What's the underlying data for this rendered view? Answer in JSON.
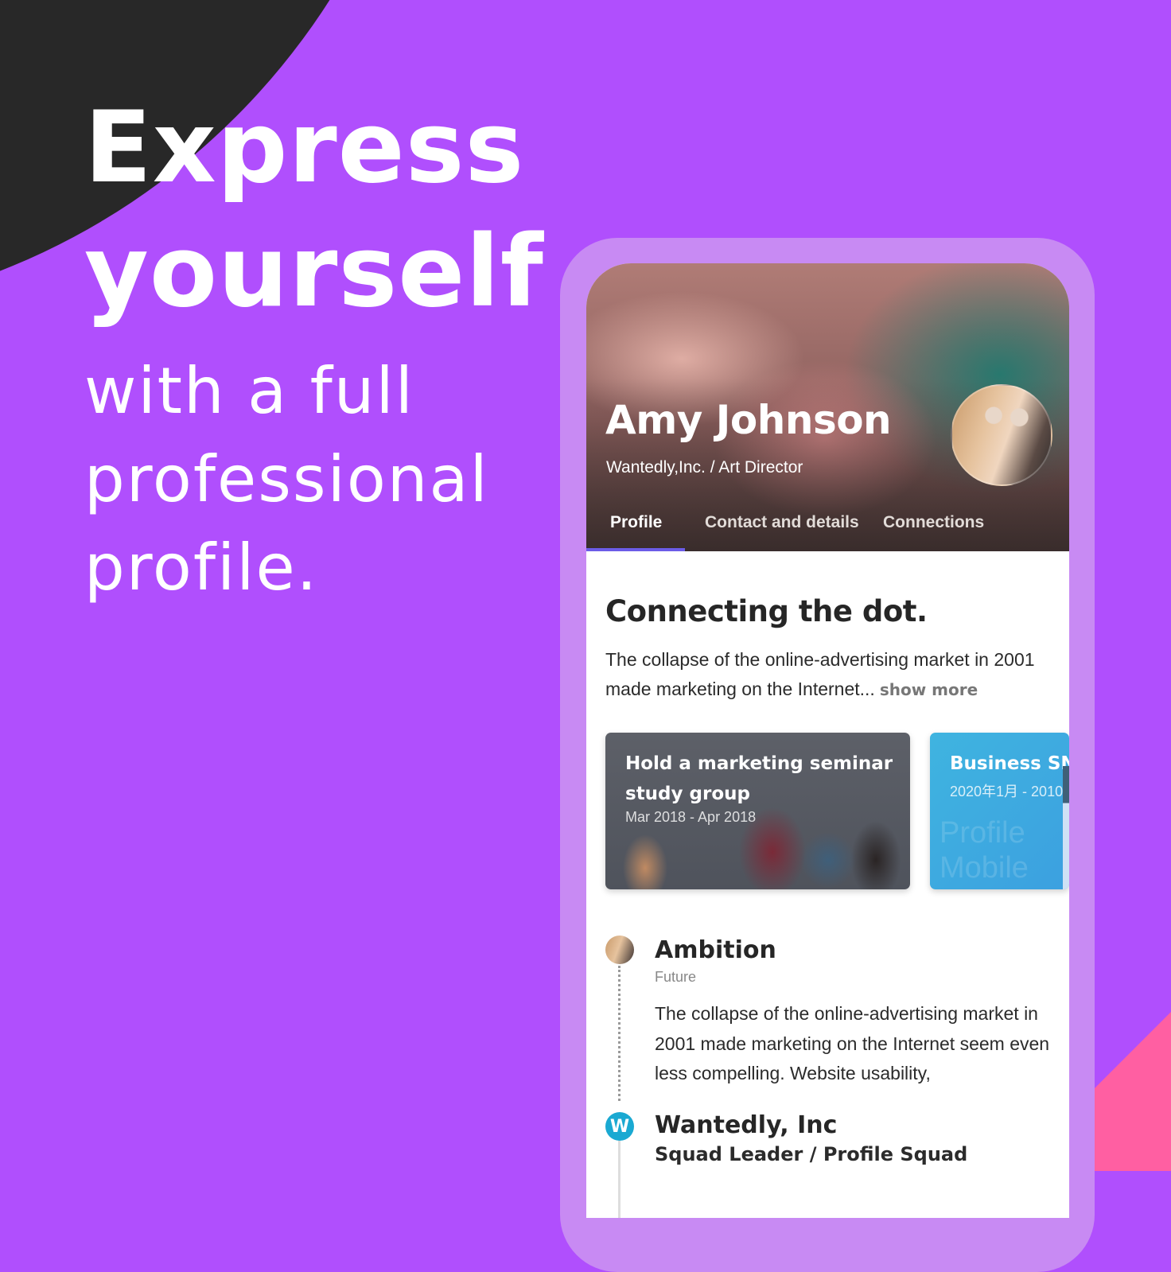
{
  "colors": {
    "background": "#b04ffd",
    "dark_arc": "#282828",
    "pink_accent": "#ff5fa2",
    "phone_frame": "#c88af3",
    "tab_indicator": "#6b5ce7",
    "wantedly_blue": "#1aa9d2"
  },
  "hero": {
    "headline_lines": [
      "Express",
      "yourself"
    ],
    "subline_lines": [
      "with a full",
      "professional",
      "profile."
    ]
  },
  "profile": {
    "name": "Amy Johnson",
    "subtitle": "Wantedly,Inc. / Art Director",
    "avatar_icon": "user-avatar-photo",
    "tabs": [
      {
        "label": "Profile",
        "active": true
      },
      {
        "label": "Contact and details",
        "active": false
      },
      {
        "label": "Connections",
        "active": false
      }
    ]
  },
  "about": {
    "title": "Connecting the dot.",
    "body": "The collapse of the online-advertising market in 2001 made marketing on the Internet...",
    "show_more_label": "show more"
  },
  "cards": [
    {
      "title": "Hold a marketing seminar study group",
      "date": "Mar 2018 - Apr 2018"
    },
    {
      "title": "Business SN",
      "date": "2020年1月 - 2010",
      "watermark": "Profile Mobile"
    }
  ],
  "timeline": [
    {
      "icon": "user-avatar-photo",
      "title": "Ambition",
      "subtitle": "Future",
      "body": "The collapse of the online-advertising market in 2001 made marketing on the Internet seem even less compelling. Website usability,"
    },
    {
      "icon": "wantedly-logo",
      "logo_glyph": "W",
      "title": "Wantedly, Inc",
      "role": "Squad Leader / Profile Squad"
    }
  ]
}
